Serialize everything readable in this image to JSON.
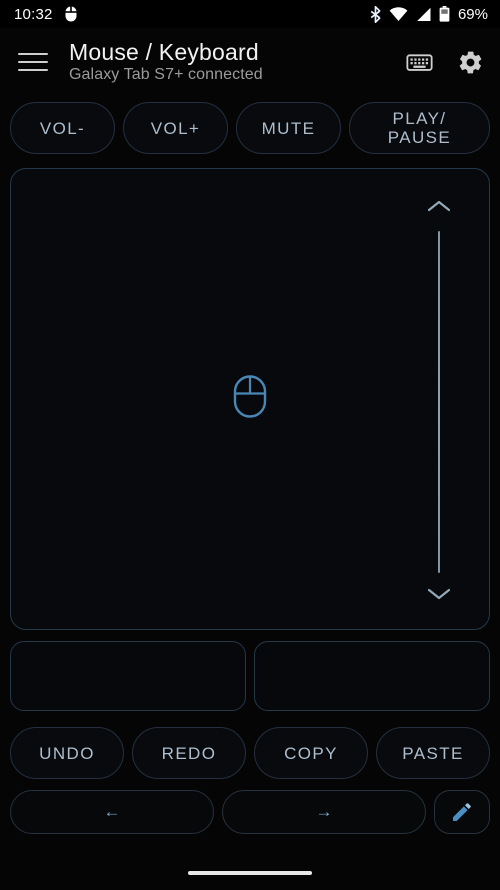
{
  "status_bar": {
    "time": "10:32",
    "mouse_icon": "mouse-icon",
    "bluetooth_icon": "bluetooth-icon",
    "wifi_icon": "wifi-icon",
    "cell_signal_icon": "cell-signal-icon",
    "battery_icon": "battery-icon",
    "battery_text": "69%"
  },
  "app_bar": {
    "menu_icon": "hamburger-menu-icon",
    "title": "Mouse / Keyboard",
    "subtitle": "Galaxy Tab S7+ connected",
    "keyboard_icon": "keyboard-icon",
    "settings_icon": "gear-icon"
  },
  "media_buttons": [
    {
      "label": "VOL-",
      "name": "volume-down-button"
    },
    {
      "label": "VOL+",
      "name": "volume-up-button"
    },
    {
      "label": "MUTE",
      "name": "mute-button"
    },
    {
      "label": "PLAY/\nPAUSE",
      "name": "play-pause-button"
    }
  ],
  "touchpad": {
    "name": "touchpad-area",
    "center_icon": "mouse-icon",
    "scroll_up_icon": "chevron-up-icon",
    "scroll_down_icon": "chevron-down-icon",
    "scroll_track": "scroll-track"
  },
  "click_panels": [
    {
      "name": "left-click-panel",
      "label": ""
    },
    {
      "name": "right-click-panel",
      "label": ""
    }
  ],
  "edit_buttons": [
    {
      "label": "UNDO",
      "name": "undo-button"
    },
    {
      "label": "REDO",
      "name": "redo-button"
    },
    {
      "label": "COPY",
      "name": "copy-button"
    },
    {
      "label": "PASTE",
      "name": "paste-button"
    }
  ],
  "nav_row": {
    "back_label": "←",
    "forward_label": "→",
    "edit_icon": "pencil-icon"
  },
  "system_nav": {
    "gesture_pill": "gesture-nav-pill"
  },
  "colors": {
    "background": "#050505",
    "accent_blue": "#5b9bd5",
    "button_text": "#aebecd",
    "border": "#243040",
    "title_text": "#f2f2f2",
    "subtitle_text": "#9b9b9b"
  }
}
